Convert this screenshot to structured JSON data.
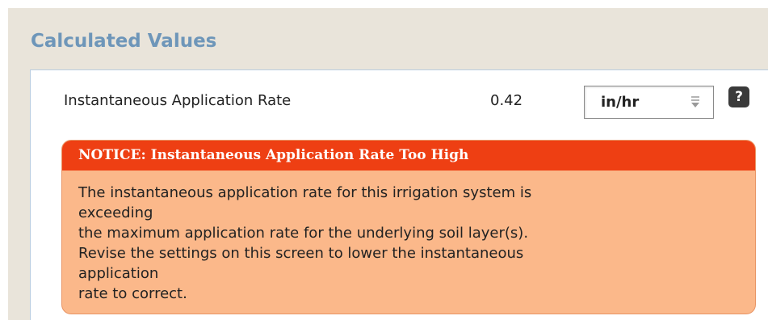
{
  "section": {
    "title": "Calculated Values"
  },
  "row": {
    "label": "Instantaneous Application Rate",
    "value": "0.42",
    "unit": "in/hr",
    "help_icon": "?"
  },
  "notice": {
    "title": "NOTICE: Instantaneous Application Rate Too High",
    "lines": [
      "The instantaneous application rate for this irrigation system is",
      "exceeding",
      "the maximum application rate for the underlying soil layer(s).",
      "Revise the settings on this screen to lower the instantaneous",
      "application",
      "rate to correct."
    ]
  },
  "colors": {
    "title_blue": "#6e96b9",
    "notice_header": "#ee3f13",
    "notice_body": "#fbb88a",
    "panel_bg": "#e9e4da"
  },
  "icons": {
    "select_arrow": "dropdown-arrow-icon",
    "help": "help-icon"
  }
}
